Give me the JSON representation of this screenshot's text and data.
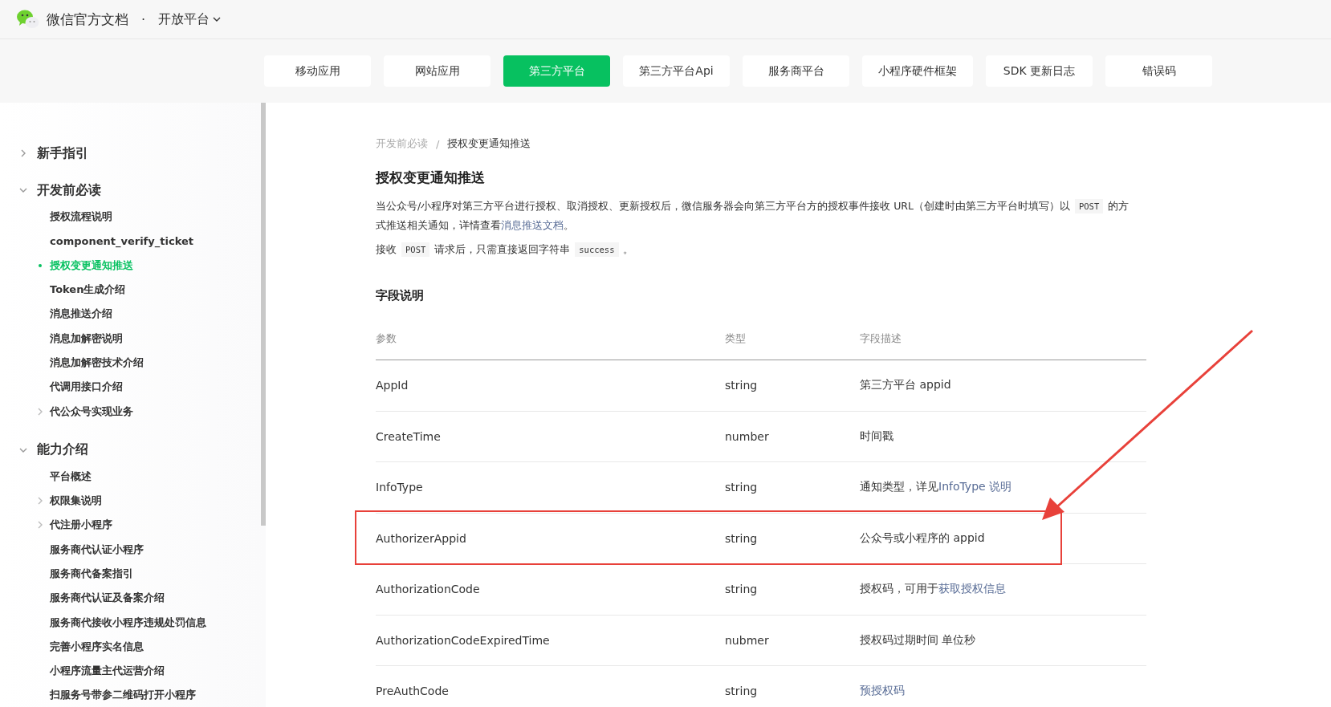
{
  "header": {
    "site_title": "微信官方文档",
    "separator": "·",
    "section": "开放平台"
  },
  "nav_tabs": [
    {
      "label": "移动应用",
      "selected": false
    },
    {
      "label": "网站应用",
      "selected": false
    },
    {
      "label": "第三方平台",
      "selected": true
    },
    {
      "label": "第三方平台Api",
      "selected": false
    },
    {
      "label": "服务商平台",
      "selected": false
    },
    {
      "label": "小程序硬件框架",
      "selected": false
    },
    {
      "label": "SDK 更新日志",
      "selected": false
    },
    {
      "label": "错误码",
      "selected": false
    }
  ],
  "sidebar": {
    "groups": [
      {
        "label": "新手指引",
        "expanded": false
      },
      {
        "label": "开发前必读",
        "expanded": true,
        "children": [
          {
            "label": "授权流程说明",
            "kind": "leaf",
            "selected": false
          },
          {
            "label": "component_verify_ticket",
            "kind": "leaf",
            "selected": false
          },
          {
            "label": "授权变更通知推送",
            "kind": "leaf",
            "selected": true
          },
          {
            "label": "Token生成介绍",
            "kind": "leaf",
            "selected": false
          },
          {
            "label": "消息推送介绍",
            "kind": "leaf",
            "selected": false
          },
          {
            "label": "消息加解密说明",
            "kind": "leaf",
            "selected": false
          },
          {
            "label": "消息加解密技术介绍",
            "kind": "leaf",
            "selected": false
          },
          {
            "label": "代调用接口介绍",
            "kind": "leaf",
            "selected": false
          },
          {
            "label": "代公众号实现业务",
            "kind": "folder",
            "selected": false
          }
        ]
      },
      {
        "label": "能力介绍",
        "expanded": true,
        "children": [
          {
            "label": "平台概述",
            "kind": "leaf",
            "selected": false
          },
          {
            "label": "权限集说明",
            "kind": "folder",
            "selected": false
          },
          {
            "label": "代注册小程序",
            "kind": "folder",
            "selected": false
          },
          {
            "label": "服务商代认证小程序",
            "kind": "leaf",
            "selected": false
          },
          {
            "label": "服务商代备案指引",
            "kind": "leaf",
            "selected": false
          },
          {
            "label": "服务商代认证及备案介绍",
            "kind": "leaf",
            "selected": false
          },
          {
            "label": "服务商代接收小程序违规处罚信息",
            "kind": "leaf",
            "selected": false
          },
          {
            "label": "完善小程序实名信息",
            "kind": "leaf",
            "selected": false
          },
          {
            "label": "小程序流量主代运营介绍",
            "kind": "leaf",
            "selected": false
          },
          {
            "label": "扫服务号带参二维码打开小程序",
            "kind": "leaf",
            "selected": false
          }
        ]
      }
    ]
  },
  "breadcrumb": [
    {
      "label": "开发前必读",
      "selected": false
    },
    {
      "label": "授权变更通知推送",
      "selected": true
    }
  ],
  "breadcrumb_separator": "/",
  "page_title": "授权变更通知推送",
  "paragraphs": [
    [
      {
        "kind": "text",
        "text": "当公众号/小程序对第三方平台进行授权、取消授权、更新授权后，微信服务器会向第三方平台方的授权事件接收 URL（创建时由第三方平台时填写）以 "
      },
      {
        "kind": "code",
        "text": "POST"
      },
      {
        "kind": "text",
        "text": " 的方式推送相关通知，详情查看"
      },
      {
        "kind": "link",
        "text": "消息推送文档"
      },
      {
        "kind": "text",
        "text": "。"
      }
    ],
    [
      {
        "kind": "text",
        "text": "接收 "
      },
      {
        "kind": "code",
        "text": "POST"
      },
      {
        "kind": "text",
        "text": " 请求后，只需直接返回字符串 "
      },
      {
        "kind": "code",
        "text": "success"
      },
      {
        "kind": "text",
        "text": " 。"
      }
    ]
  ],
  "section_title": "字段说明",
  "table": {
    "columns": [
      "参数",
      "类型",
      "字段描述"
    ],
    "rows": [
      {
        "param": "AppId",
        "type": "string",
        "description": [
          {
            "kind": "text",
            "text": "第三方平台 appid"
          }
        ],
        "highlighted": false
      },
      {
        "param": "CreateTime",
        "type": "number",
        "description": [
          {
            "kind": "text",
            "text": "时间戳"
          }
        ],
        "highlighted": false
      },
      {
        "param": "InfoType",
        "type": "string",
        "description": [
          {
            "kind": "text",
            "text": "通知类型，详见"
          },
          {
            "kind": "link",
            "text": "InfoType 说明"
          }
        ],
        "highlighted": false
      },
      {
        "param": "AuthorizerAppid",
        "type": "string",
        "description": [
          {
            "kind": "text",
            "text": "公众号或小程序的 appid"
          }
        ],
        "highlighted": true
      },
      {
        "param": "AuthorizationCode",
        "type": "string",
        "description": [
          {
            "kind": "text",
            "text": "授权码，可用于"
          },
          {
            "kind": "link",
            "text": "获取授权信息"
          }
        ],
        "highlighted": false
      },
      {
        "param": "AuthorizationCodeExpiredTime",
        "type": "nubmer",
        "description": [
          {
            "kind": "text",
            "text": "授权码过期时间 单位秒"
          }
        ],
        "highlighted": false
      },
      {
        "param": "PreAuthCode",
        "type": "string",
        "description": [
          {
            "kind": "link",
            "text": "预授权码"
          }
        ],
        "highlighted": false
      }
    ]
  },
  "annotation_arrow": true
}
